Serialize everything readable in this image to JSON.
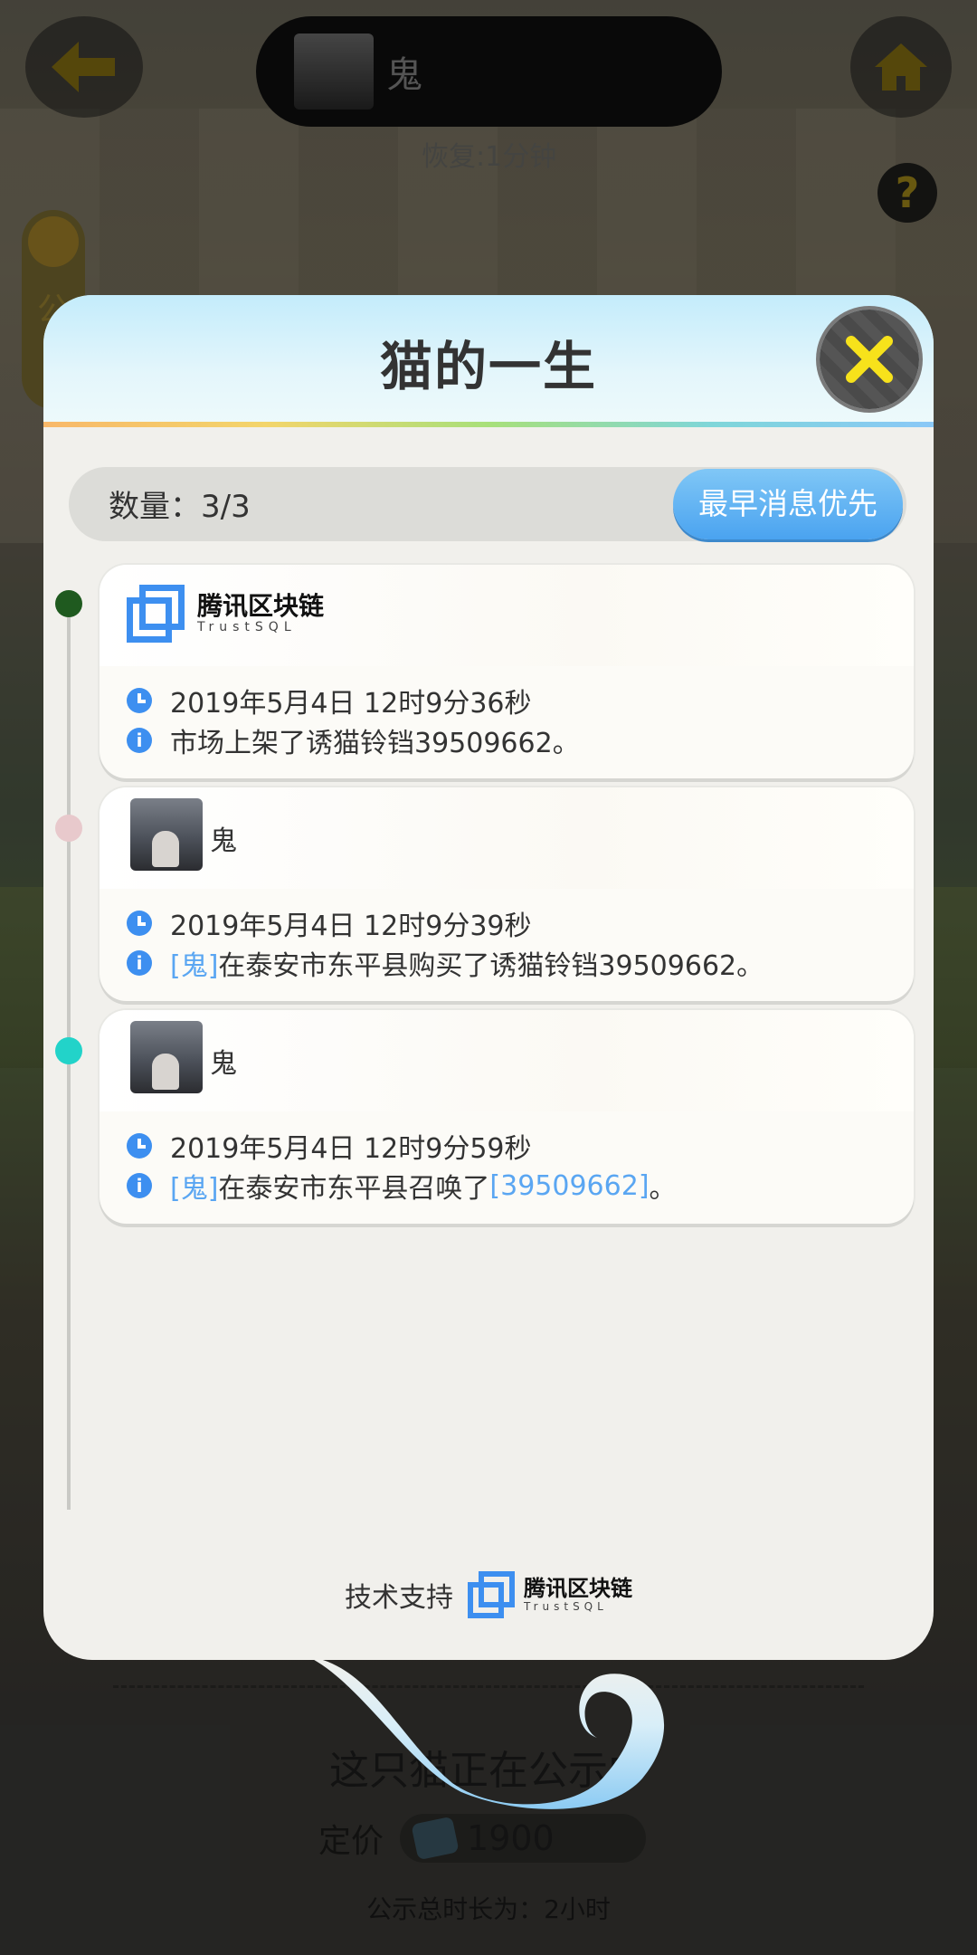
{
  "background": {
    "owner_name": "鬼",
    "recover_text": "恢复:1分钟",
    "side_tab_label": "公",
    "help_label": "?",
    "panel_title": "这只猫正在公示中",
    "price_label": "定价",
    "price_value": "1900",
    "duration_text": "公示总时长为：2小时"
  },
  "modal": {
    "title": "猫的一生",
    "count_text": "数量：3/3",
    "sort_button": "最早消息优先",
    "footer_support": "技术支持"
  },
  "brand": {
    "name_cn": "腾讯区块链",
    "name_en": "TrustSQL"
  },
  "events": [
    {
      "actor_type": "logo",
      "dot_color": "#1f5a1f",
      "time": "2019年5月4日 12时9分36秒",
      "message_plain": "市场上架了诱猫铃铛39509662。"
    },
    {
      "actor_type": "user",
      "actor_name": "鬼",
      "dot_color": "#e8c9cc",
      "time": "2019年5月4日 12时9分39秒",
      "msg_link": "[鬼]",
      "msg_rest": "在泰安市东平县购买了诱猫铃铛39509662。"
    },
    {
      "actor_type": "user",
      "actor_name": "鬼",
      "dot_color": "#22d3c9",
      "time": "2019年5月4日 12时9分59秒",
      "msg_link": "[鬼]",
      "msg_mid": "在泰安市东平县召唤了",
      "msg_link2": "[39509662]",
      "msg_end": "。"
    }
  ],
  "colors": {
    "accent_blue": "#3d8ff0",
    "link_blue": "#5aa6f2",
    "close_yellow": "#f7e21b"
  }
}
